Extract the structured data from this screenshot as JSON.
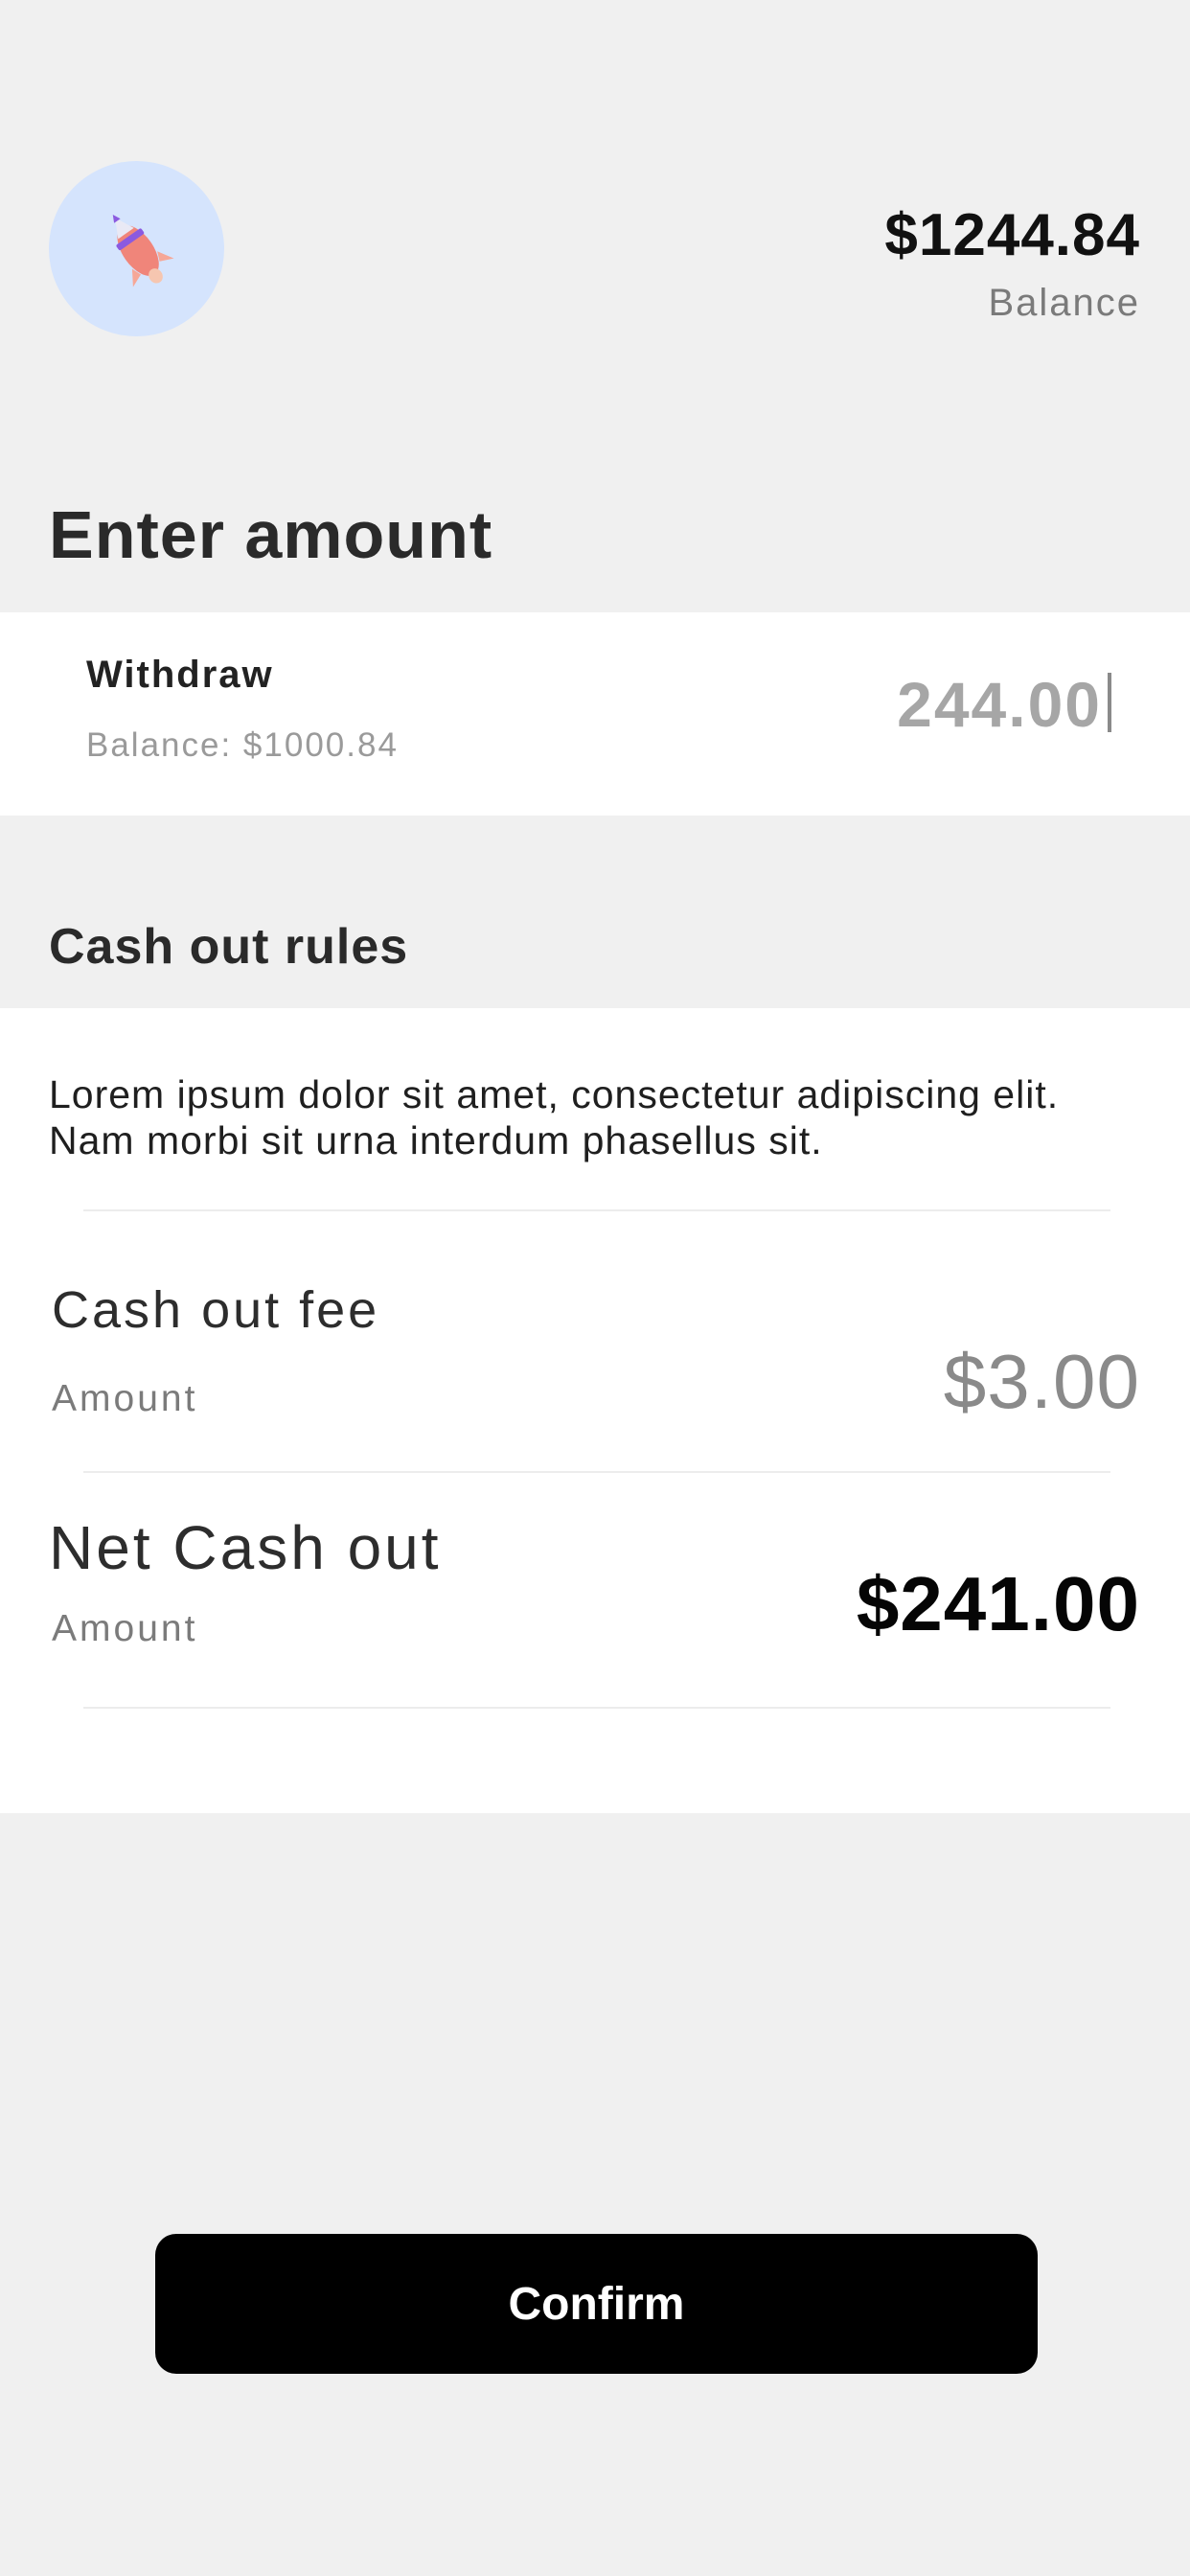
{
  "header": {
    "avatar_icon": "rocket-icon",
    "balance_amount": "$1244.84",
    "balance_label": "Balance"
  },
  "enter_amount": {
    "title": "Enter amount",
    "withdraw_label": "Withdraw",
    "withdraw_balance": "Balance: $1000.84",
    "amount_value": "244.00"
  },
  "rules": {
    "title": "Cash out rules",
    "text": "Lorem ipsum dolor sit amet, consectetur adipiscing elit. Nam morbi sit urna interdum phasellus sit.",
    "fee_label": "Cash out fee",
    "fee_sub": "Amount",
    "fee_value": "$3.00",
    "net_label": "Net Cash out",
    "net_sub": "Amount",
    "net_value": "$241.00"
  },
  "actions": {
    "confirm_label": "Confirm"
  },
  "colors": {
    "background": "#f0f0f0",
    "card": "#ffffff",
    "avatar_bg": "#d5e4fd",
    "button_bg": "#000000",
    "button_text": "#ffffff"
  }
}
